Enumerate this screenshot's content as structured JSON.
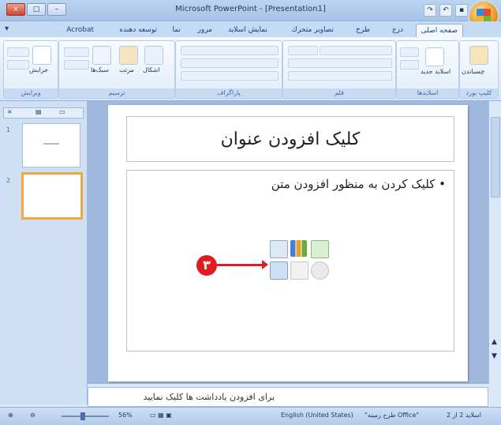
{
  "window": {
    "title": "Microsoft PowerPoint - [Presentation1]",
    "controls": [
      "×",
      "□",
      "–"
    ]
  },
  "ribbon": {
    "tabs": [
      "صفحه اصلی",
      "درج",
      "طرح",
      "تصاویر متحرك",
      "نمایش اسلاید",
      "مرور",
      "نما",
      "توسعه دهنده",
      "Acrobat"
    ],
    "groups": [
      "کلیپ بورد",
      "اسلایدها",
      "قلم",
      "پاراگراف",
      "ترسیم",
      "ویرایش"
    ],
    "buttons": {
      "find": "جرایش",
      "shapes": "اشکال",
      "arrange": "مرتب",
      "styles": "سبک‌ها",
      "new_slide": "اسلاید جدید",
      "paste": "چسباندن"
    }
  },
  "thumbnails": [
    {
      "num": "1"
    },
    {
      "num": "2"
    }
  ],
  "slide": {
    "title": "کلیک افزودن عنوان",
    "bullet": "کلیک کردن به منظور افزودن متن",
    "marker": "۳"
  },
  "notes": {
    "placeholder": "برای افزودن یادداشت ها کلیک نمایید"
  },
  "status": {
    "slide": "اسلاید 2 از 2",
    "theme": "\"طرح زمینه Office\"",
    "language": "English (United States)",
    "zoom": "56%"
  }
}
